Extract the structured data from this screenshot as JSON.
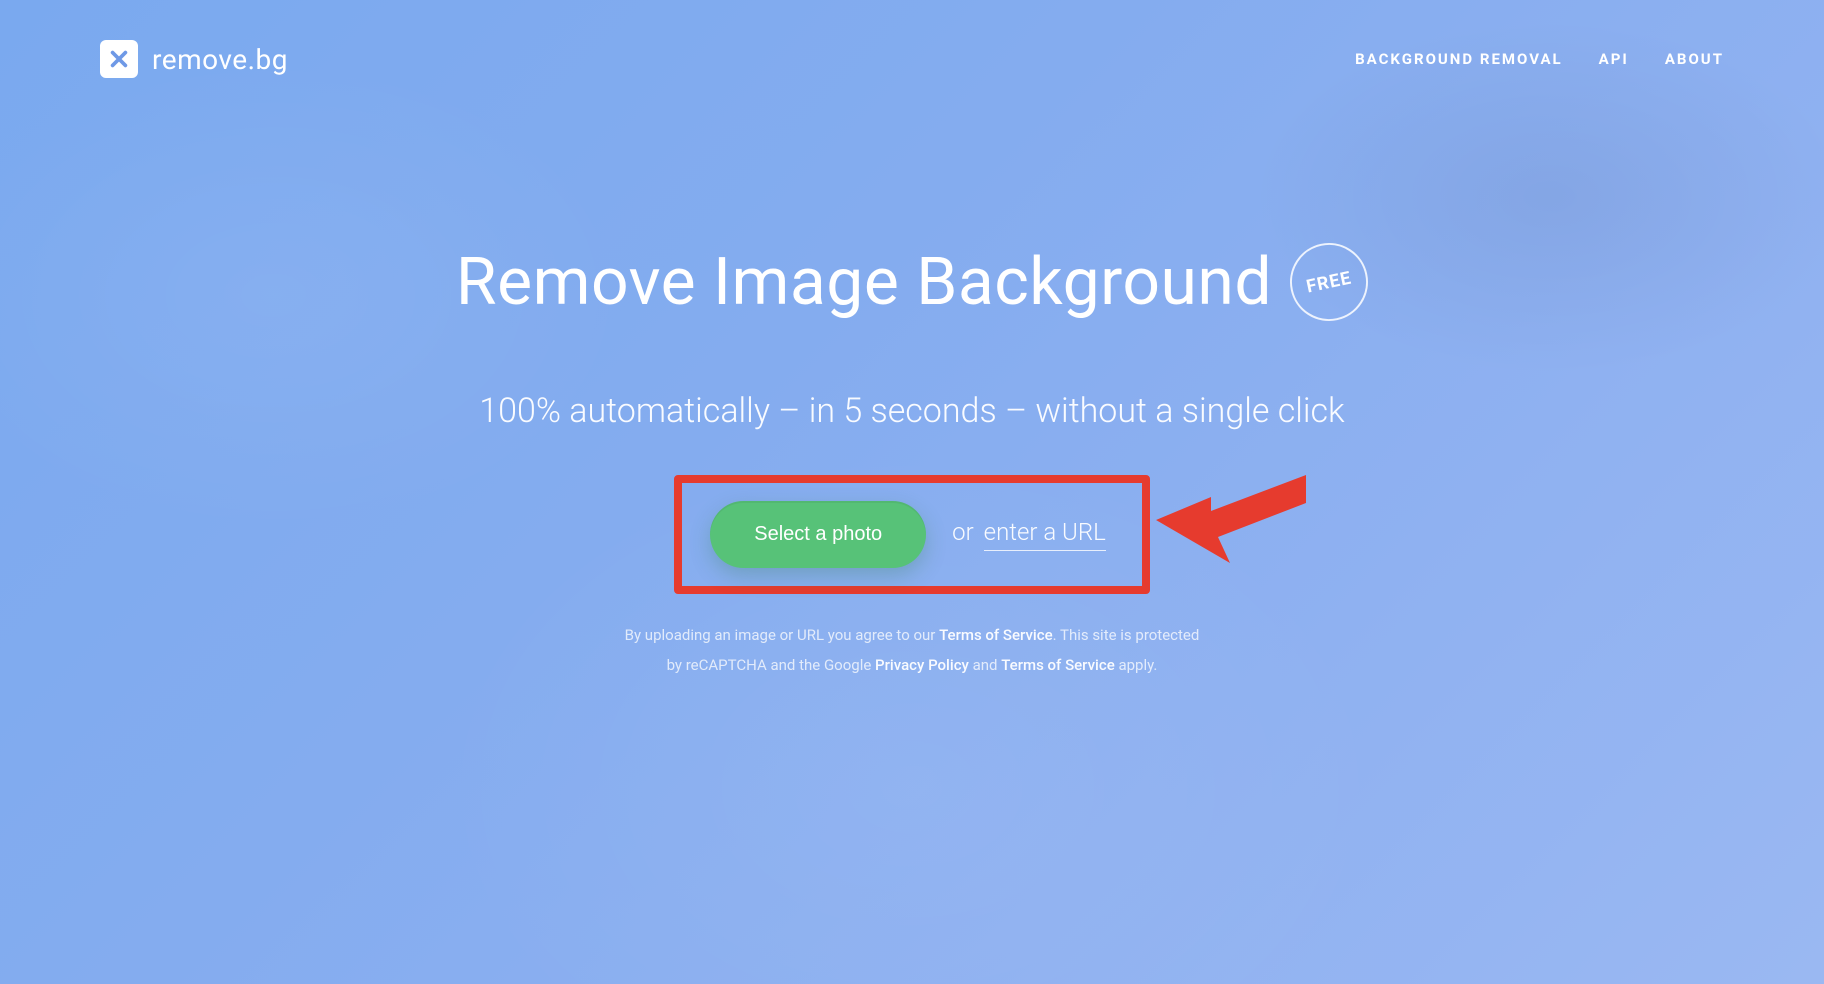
{
  "brand": {
    "name": "remove.bg"
  },
  "nav": {
    "items": [
      {
        "label": "BACKGROUND REMOVAL"
      },
      {
        "label": "API"
      },
      {
        "label": "ABOUT"
      }
    ]
  },
  "hero": {
    "headline": "Remove Image Background",
    "badge": "FREE",
    "subhead": "100% automatically – in 5 seconds – without a single click",
    "select_button": "Select a photo",
    "or_text": "or",
    "url_link": "enter a URL"
  },
  "legal": {
    "part1": "By uploading an image or URL you agree to our ",
    "tos1": "Terms of Service",
    "part2": ". This site is protected",
    "part3": "by reCAPTCHA and the Google ",
    "privacy": "Privacy Policy",
    "and": " and ",
    "tos2": "Terms of Service",
    "apply": " apply."
  },
  "annotation": {
    "highlight_color": "#e63b2e"
  }
}
